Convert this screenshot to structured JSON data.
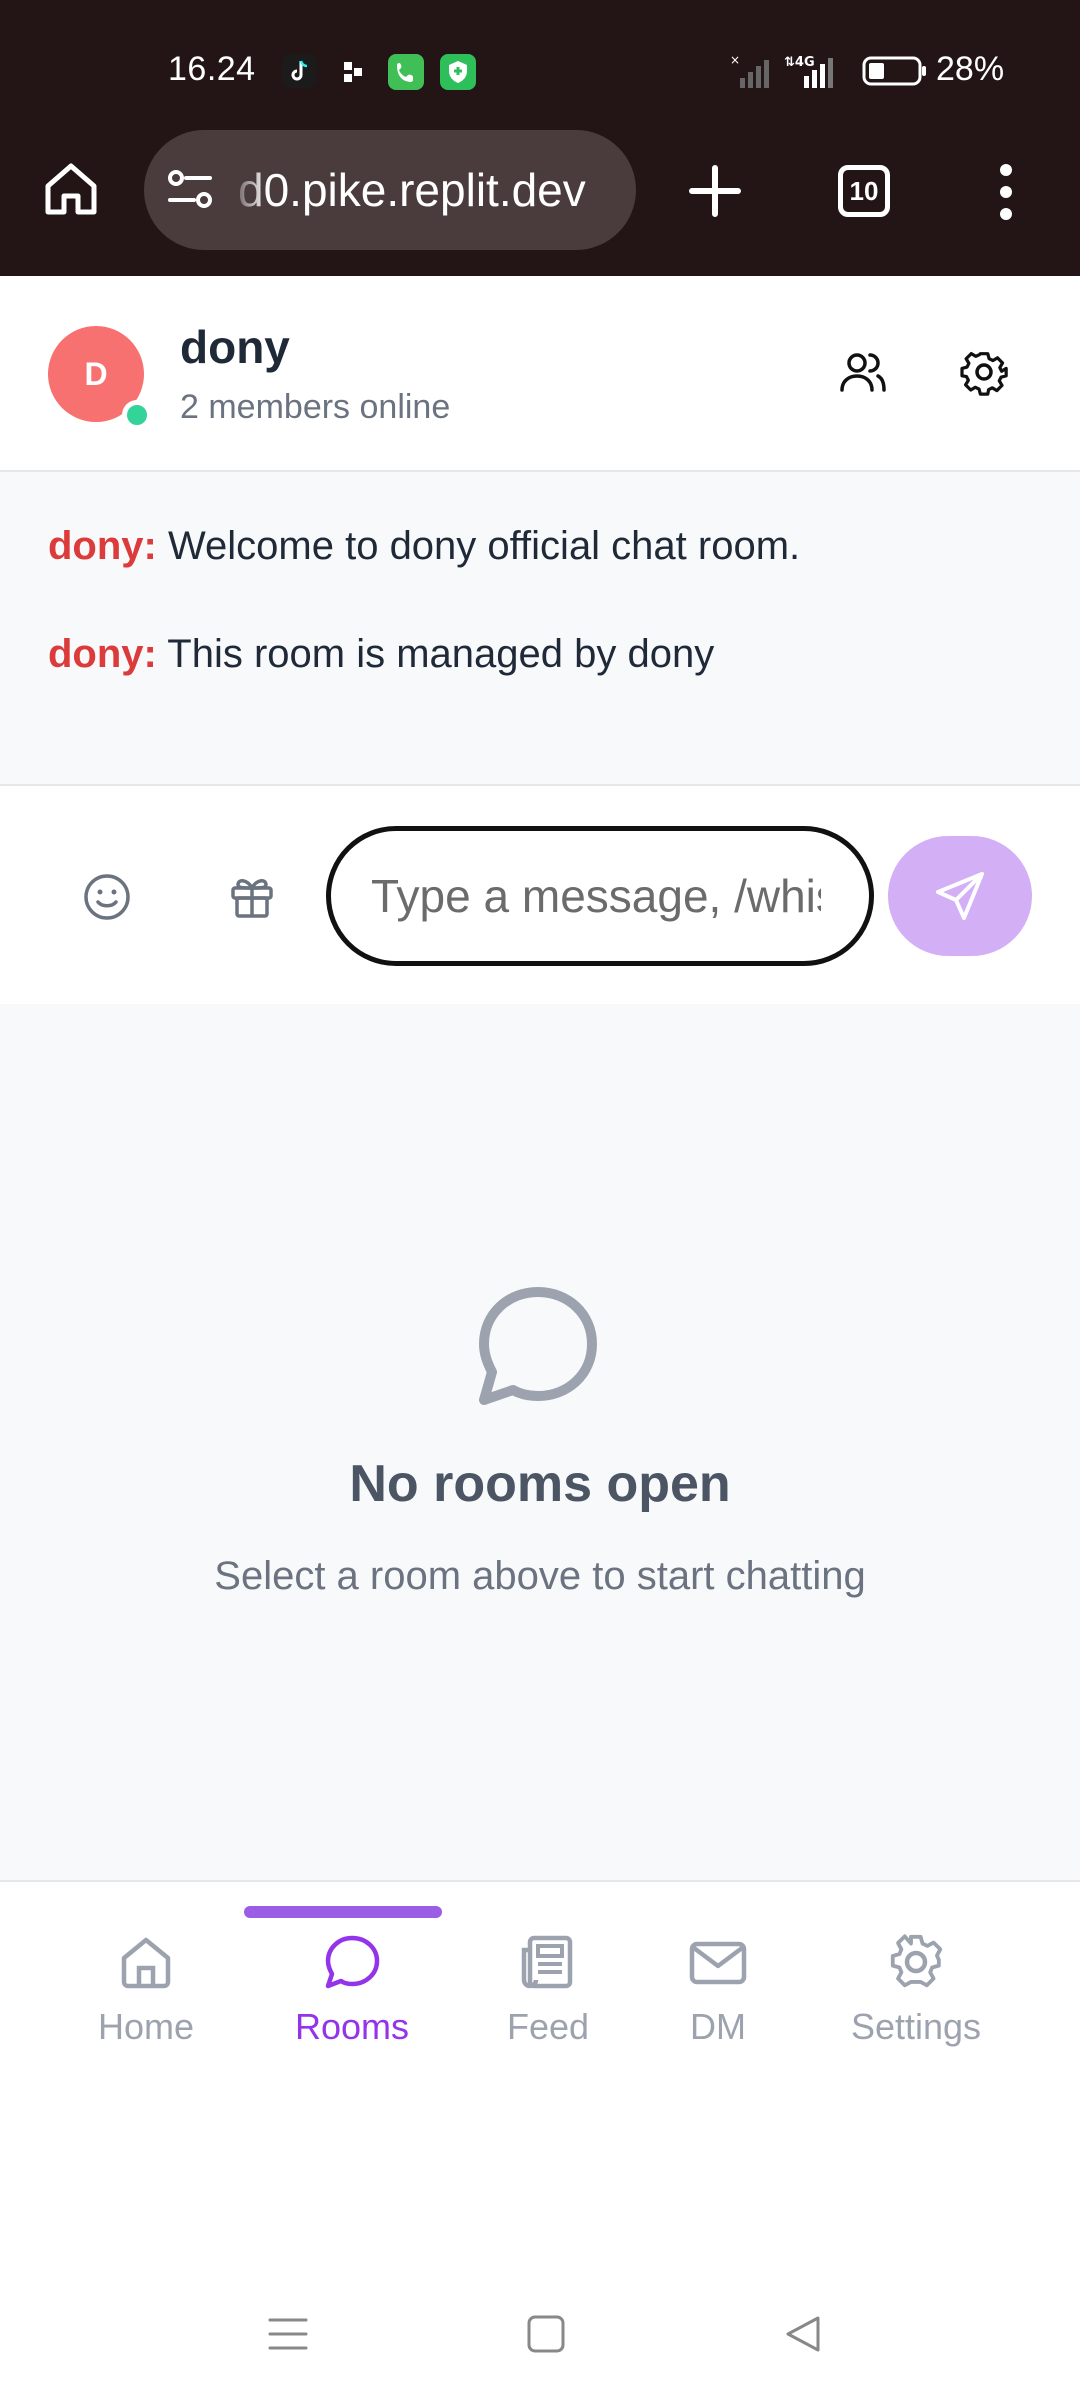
{
  "status_bar": {
    "time": "16.24",
    "battery": "28%",
    "icons": [
      "tiktok-icon",
      "app-icon",
      "phone-icon",
      "shield-icon",
      "signal-icon",
      "4g-signal-icon",
      "battery-icon"
    ]
  },
  "browser": {
    "url": "d0.pike.replit.dev",
    "tab_count": "10",
    "icons": [
      "home-icon",
      "site-settings-icon",
      "new-tab-icon",
      "tabs-icon",
      "more-icon"
    ]
  },
  "room": {
    "avatar_letter": "D",
    "name": "dony",
    "members_online": "2 members online"
  },
  "messages": [
    {
      "author": "dony:",
      "text": "Welcome to dony official chat room."
    },
    {
      "author": "dony:",
      "text": "This room is managed by dony"
    }
  ],
  "composer": {
    "placeholder": "Type a message, /whisper"
  },
  "empty_state": {
    "title": "No rooms open",
    "subtitle": "Select a room above to start chatting"
  },
  "bottom_nav": {
    "items": [
      {
        "label": "Home",
        "icon": "home-icon",
        "active": false
      },
      {
        "label": "Rooms",
        "icon": "chat-bubble-icon",
        "active": true
      },
      {
        "label": "Feed",
        "icon": "newspaper-icon",
        "active": false
      },
      {
        "label": "DM",
        "icon": "mail-icon",
        "active": false
      },
      {
        "label": "Settings",
        "icon": "gear-icon",
        "active": false
      }
    ]
  },
  "colors": {
    "accent": "#9333ea",
    "send_button": "#d3b0f5",
    "author": "#dc3b3b",
    "avatar": "#f87171",
    "online": "#34d399"
  }
}
